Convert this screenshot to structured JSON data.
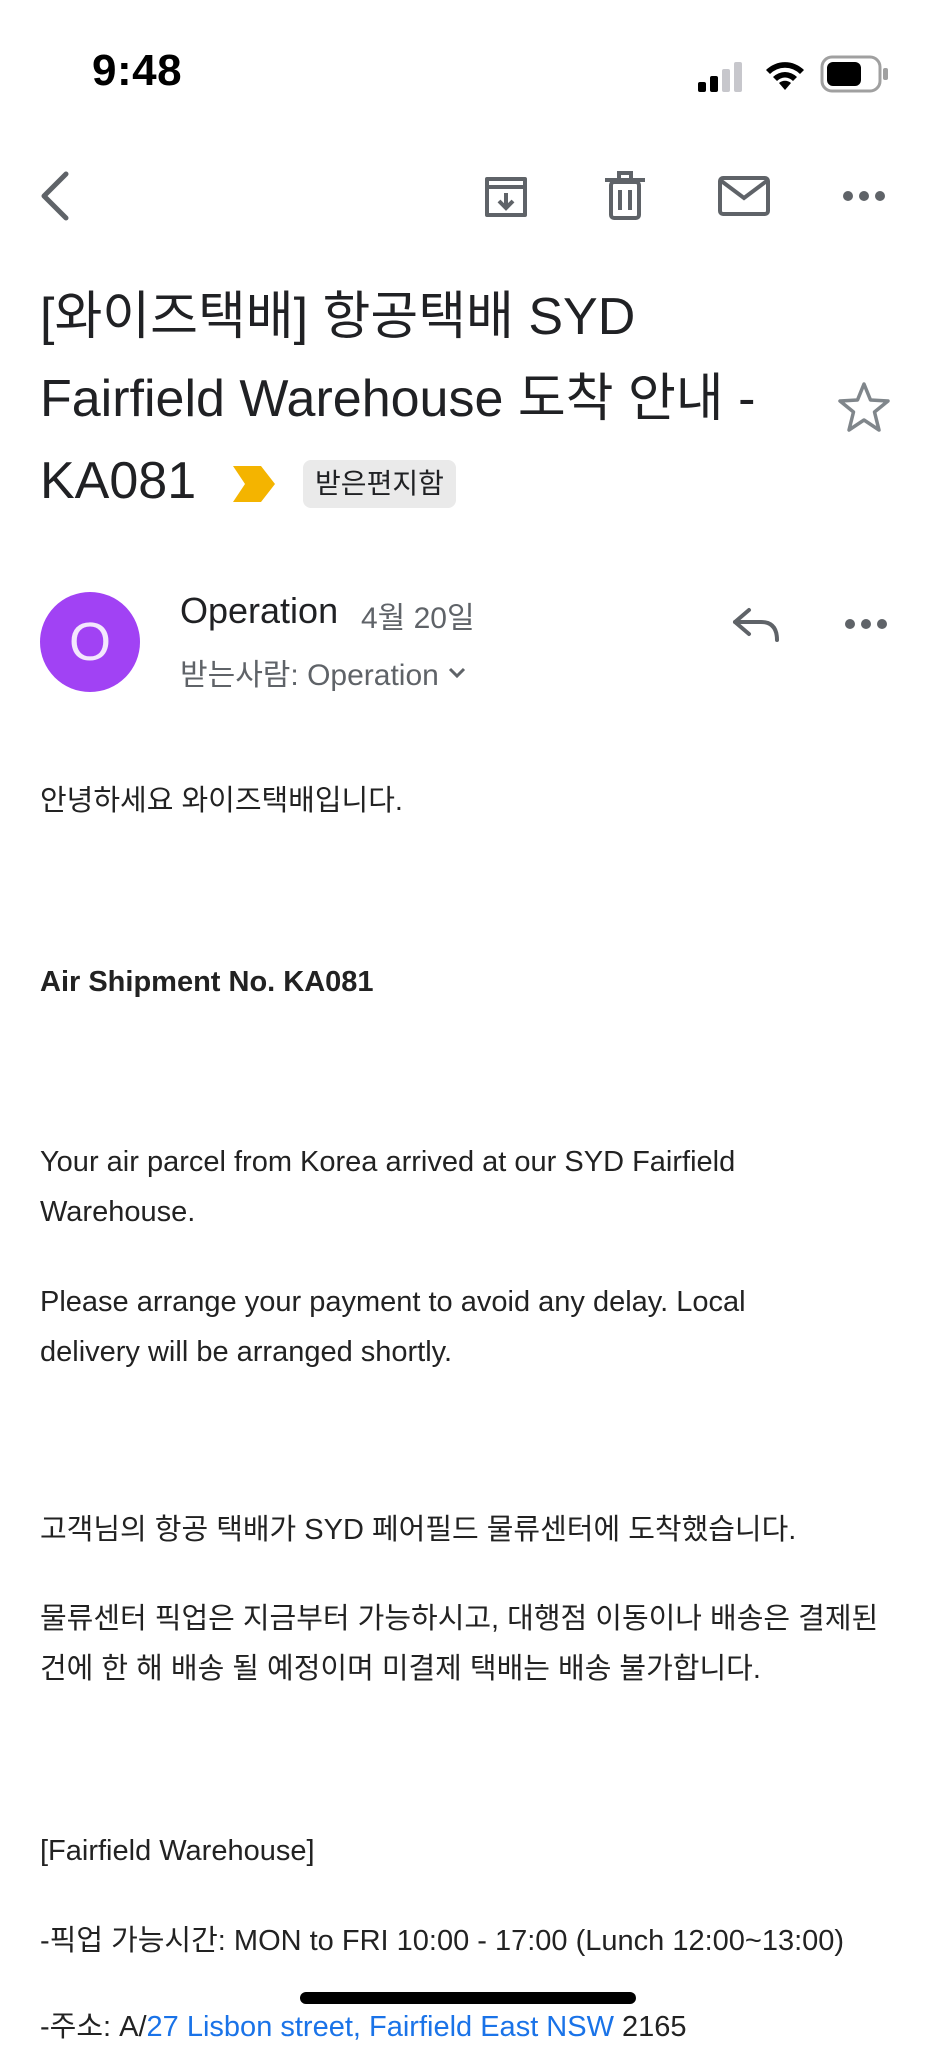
{
  "status_bar": {
    "time": "9:48"
  },
  "email": {
    "subject": "[와이즈택배] 항공택배 SYD Fairfield Warehouse 도착 안내 - KA081",
    "label": "받은편지함",
    "sender": {
      "avatar_letter": "O",
      "name": "Operation",
      "date": "4월 20일",
      "recipient": "받는사람: Operation"
    },
    "body": {
      "greeting": "안녕하세요 와이즈택배입니다.",
      "shipment_heading": "Air Shipment No. KA081",
      "para1": "Your air parcel from Korea arrived at our SYD Fairfield Warehouse.",
      "para2": "Please arrange your payment to avoid any delay. Local delivery will be arranged shortly.",
      "para3": "고객님의 항공 택배가 SYD 페어필드 물류센터에 도착했습니다.",
      "para4": "물류센터 픽업은 지금부터 가능하시고, 대행점 이동이나 배송은 결제된 건에 한 해 배송 될 예정이며 미결제 택배는 배송 불가합니다.",
      "warehouse_heading": "[Fairfield Warehouse]",
      "pickup_hours": "-픽업 가능시간: MON to FRI 10:00 - 17:00 (Lunch 12:00~13:00)",
      "address_prefix": "-주소: A/",
      "address_link": "27 Lisbon street, Fairfield East NSW",
      "address_suffix": " 2165"
    }
  },
  "colors": {
    "avatar_bg": "#a142f4",
    "importance_marker": "#f4b400",
    "link": "#1a73e8",
    "label_chip_bg": "#eaeaea"
  },
  "icons": {
    "back": "back-arrow-icon",
    "archive": "archive-icon",
    "delete": "trash-icon",
    "mark_unread": "mail-icon",
    "more": "more-horizontal-icon",
    "star": "star-outline-icon",
    "reply": "reply-icon",
    "expand": "chevron-down-icon"
  }
}
